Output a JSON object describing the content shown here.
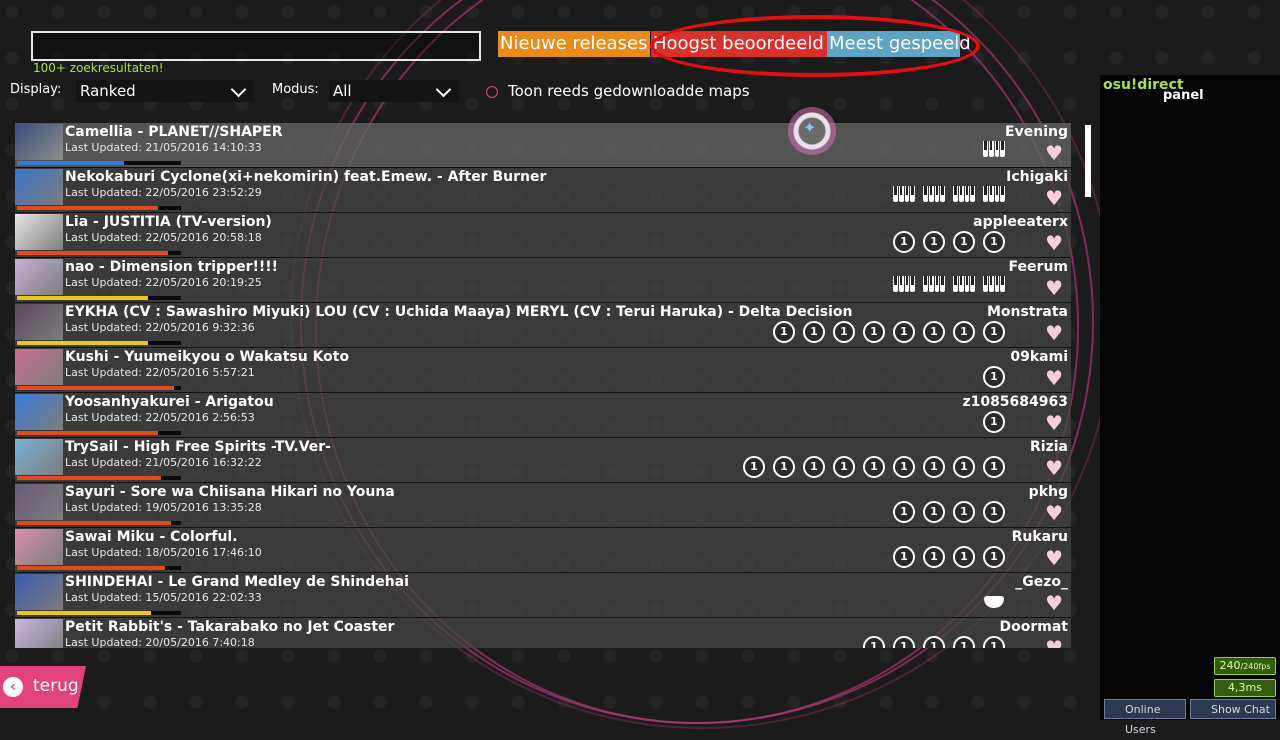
{
  "search": {
    "value": "",
    "result_count": "100+ zoekresultaten!"
  },
  "tabs": {
    "new": "Nieuwe releases",
    "rated": "Hoogst beoordeeld",
    "played": "Meest gespeeld"
  },
  "filters": {
    "display_label": "Display:",
    "display_value": "Ranked",
    "mode_label": "Modus:",
    "mode_value": "All",
    "downloaded_label": "Toon reeds gedownloadde maps"
  },
  "beatmaps": [
    {
      "title": "Camellia - PLANET//SHAPER",
      "updated": "Last Updated: 21/05/2016 14:10:33",
      "creator": "Evening",
      "diffs": [
        "mania"
      ],
      "bar_color": "#3a7ad8",
      "progress": 0.65,
      "thumb": "#3a4e7a"
    },
    {
      "title": "Nekokaburi Cyclone(xi+nekomirin) feat.Emew. - After Burner",
      "updated": "Last Updated: 22/05/2016 23:52:29",
      "creator": "Ichigaki",
      "diffs": [
        "mania",
        "mania",
        "mania",
        "mania"
      ],
      "bar_color": "#e04a1c",
      "progress": 0.86,
      "thumb": "#3a74c8"
    },
    {
      "title": "Lia - JUSTITIA (TV-version)",
      "updated": "Last Updated: 22/05/2016 20:58:18",
      "creator": "appleeaterx",
      "diffs": [
        "std",
        "std",
        "std",
        "std"
      ],
      "bar_color": "#e04a1c",
      "progress": 0.92,
      "thumb": "#e8e8e8"
    },
    {
      "title": "nao - Dimension tripper!!!!",
      "updated": "Last Updated: 22/05/2016 20:19:25",
      "creator": "Feerum",
      "diffs": [
        "mania",
        "mania",
        "mania",
        "mania"
      ],
      "bar_color": "#e8c81c",
      "progress": 0.8,
      "thumb": "#c8b0d8"
    },
    {
      "title": "EYKHA (CV : Sawashiro Miyuki) LOU (CV : Uchida Maaya) MERYL (CV : Terui Haruka) - Delta Decision",
      "updated": "Last Updated: 22/05/2016 9:32:36",
      "creator": "Monstrata",
      "diffs": [
        "std",
        "std",
        "std",
        "std",
        "std",
        "std",
        "std",
        "std"
      ],
      "bar_color": "#e8c81c",
      "progress": 0.8,
      "thumb": "#5a4a5a"
    },
    {
      "title": "Kushi - Yuumeikyou o Wakatsu Koto",
      "updated": "Last Updated: 22/05/2016 5:57:21",
      "creator": "09kami",
      "diffs": [
        "std"
      ],
      "bar_color": "#e04a1c",
      "progress": 0.96,
      "thumb": "#c87090"
    },
    {
      "title": "Yoosanhyakurei - Arigatou",
      "updated": "Last Updated: 22/05/2016 2:56:53",
      "creator": "z1085684963",
      "diffs": [
        "std"
      ],
      "bar_color": "#e04a1c",
      "progress": 0.86,
      "thumb": "#3a7ad8"
    },
    {
      "title": "TrySail - High Free Spirits -TV.Ver-",
      "updated": "Last Updated: 21/05/2016 16:32:22",
      "creator": "Rizia",
      "diffs": [
        "std",
        "std",
        "std",
        "std",
        "std",
        "std",
        "std",
        "std",
        "std"
      ],
      "bar_color": "#e04a1c",
      "progress": 0.88,
      "thumb": "#7ab0d8"
    },
    {
      "title": "Sayuri - Sore wa Chiisana Hikari no Youna",
      "updated": "Last Updated: 19/05/2016 13:35:28",
      "creator": "pkhg",
      "diffs": [
        "std",
        "std",
        "std",
        "std"
      ],
      "bar_color": "#e04a1c",
      "progress": 0.94,
      "thumb": "#6a5a7a"
    },
    {
      "title": "Sawai Miku - Colorful.",
      "updated": "Last Updated: 18/05/2016 17:46:10",
      "creator": "Rukaru",
      "diffs": [
        "std",
        "std",
        "std",
        "std"
      ],
      "bar_color": "#e04a1c",
      "progress": 0.9,
      "thumb": "#d890b0"
    },
    {
      "title": "SHINDEHAI - Le Grand Medley de Shindehai",
      "updated": "Last Updated: 15/05/2016 22:02:33",
      "creator": "_Gezo_",
      "diffs": [
        "taiko"
      ],
      "bar_color": "#e8c81c",
      "progress": 0.82,
      "thumb": "#3a5ab0"
    },
    {
      "title": "Petit Rabbit's - Takarabako no Jet Coaster",
      "updated": "Last Updated: 20/05/2016 7:40:18",
      "creator": "Doormat",
      "diffs": [
        "std",
        "std",
        "std",
        "std",
        "std"
      ],
      "bar_color": "#e04a1c",
      "progress": 0.9,
      "thumb": "#c8b8e0"
    }
  ],
  "side_panel": {
    "title": "osu!direct",
    "subtitle": "panel"
  },
  "stats": {
    "fps": "240",
    "fps_max": "/240fps",
    "latency": "4,3ms"
  },
  "bottom_bar": {
    "online_users": "Online Users",
    "show_chat": "Show Chat"
  },
  "back_button": {
    "label": "terug"
  },
  "icons": {
    "back": "back-arrow-icon",
    "heart": "heart-icon",
    "std": "osu-standard-icon",
    "mania": "osu-mania-icon",
    "taiko": "osu-taiko-icon"
  }
}
